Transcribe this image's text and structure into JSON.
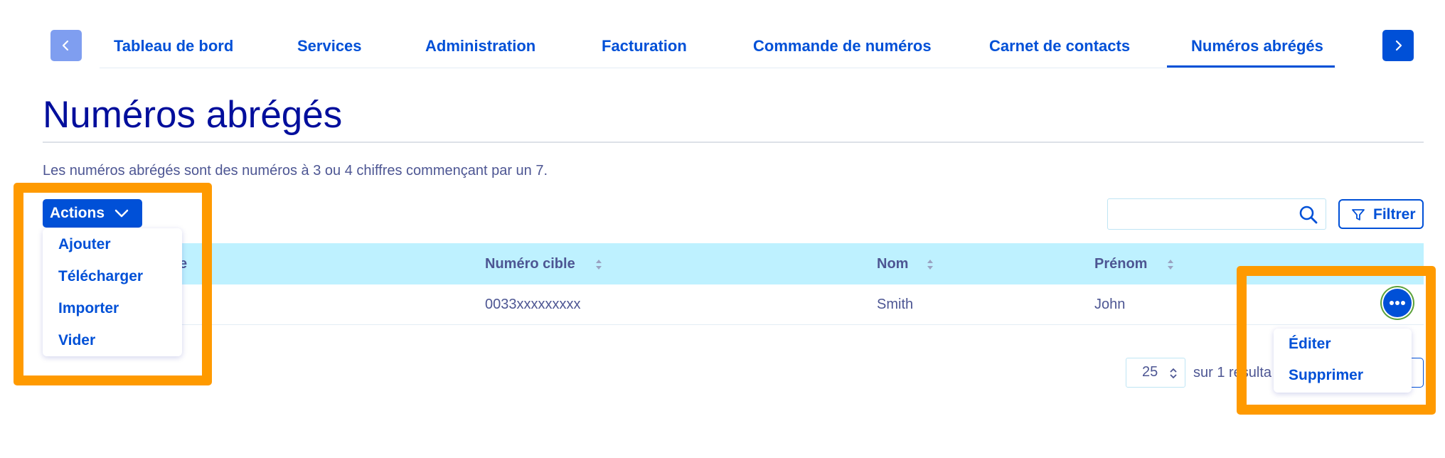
{
  "nav": {
    "prev_icon": "chevron-left-icon",
    "next_icon": "chevron-right-icon",
    "tabs": [
      {
        "label": "Tableau de bord"
      },
      {
        "label": "Services"
      },
      {
        "label": "Administration"
      },
      {
        "label": "Facturation"
      },
      {
        "label": "Commande de numéros"
      },
      {
        "label": "Carnet de contacts"
      },
      {
        "label": "Numéros abrégés",
        "active": true
      }
    ]
  },
  "page": {
    "title": "Numéros abrégés",
    "description": "Les numéros abrégés sont des numéros à 3 ou 4 chiffres commençant par un 7."
  },
  "actions": {
    "label": "Actions",
    "menu": [
      "Ajouter",
      "Télécharger",
      "Importer",
      "Vider"
    ]
  },
  "search": {
    "placeholder": "",
    "value": ""
  },
  "filter": {
    "label": "Filtrer"
  },
  "table": {
    "columns": [
      {
        "label": "e"
      },
      {
        "label": "Numéro cible"
      },
      {
        "label": "Nom"
      },
      {
        "label": "Prénom"
      }
    ],
    "rows": [
      {
        "numero_cible": "0033xxxxxxxxx",
        "nom": "Smith",
        "prenom": "John"
      }
    ],
    "row_menu": [
      "Éditer",
      "Supprimer"
    ]
  },
  "pagination": {
    "page_size": "25",
    "result_text": "sur 1 résulta"
  },
  "colors": {
    "primary": "#0050d7",
    "title": "#000e9c",
    "text": "#4d5693",
    "table_header": "#bef1ff",
    "highlight": "#ff9a00"
  }
}
